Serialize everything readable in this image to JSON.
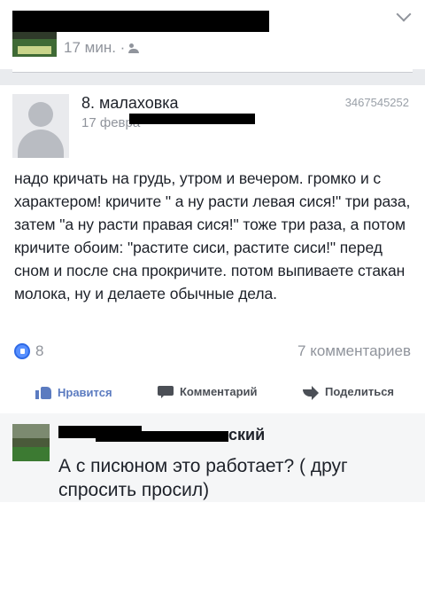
{
  "top_post": {
    "time": "17 мин. ·"
  },
  "shared_post": {
    "author": "8. малаховка",
    "post_id": "3467545252",
    "date_visible": "17 февра",
    "text": "надо кричать на грудь, утром и вечером. громко и с характером! кричите \" а ну расти левая сися!\" три раза, затем \"а ну расти правая сися!\" тоже три раза, а потом кричите обоим: \"растите сиси, растите сиси!\" перед сном и после сна прокричите. потом выпиваете стакан молока, ну и делаете обычные дела.",
    "likes": "8",
    "comments": "7 комментариев"
  },
  "actions": {
    "like_label": "Нравится",
    "comment_label": "Комментарий",
    "share_label": "Поделиться"
  },
  "comment": {
    "author_visible": "ский",
    "text": "А с писюном это работает? ( друг спросить просил)"
  },
  "colors": {
    "accent": "#5b7bc0",
    "muted": "#90949c",
    "comment_bg": "#f5f6f7",
    "band": "#e9ebee"
  }
}
